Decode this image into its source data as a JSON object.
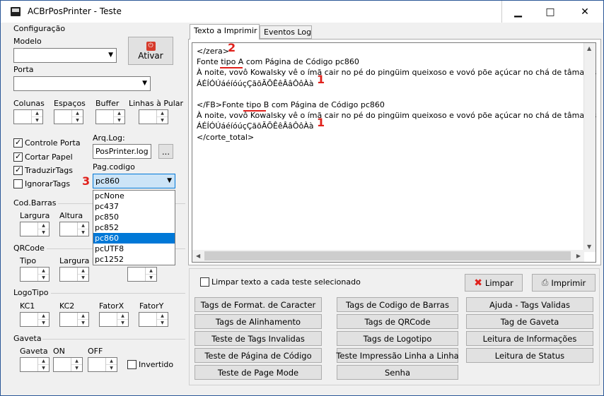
{
  "window": {
    "title": "ACBrPosPrinter - Teste",
    "minimize": "▁",
    "maximize": "□",
    "close": "✕"
  },
  "config": {
    "group_title": "Configuração",
    "modelo_label": "Modelo",
    "modelo_value": "",
    "ativar_label": "Ativar",
    "porta_label": "Porta",
    "porta_value": "",
    "colunas_label": "Colunas",
    "espacos_label": "Espaços",
    "buffer_label": "Buffer",
    "linhas_label": "Linhas à Pular",
    "controle_porta": "Controle Porta",
    "cortar_papel": "Cortar Papel",
    "traduzir_tags": "TraduzirTags",
    "ignorar_tags": "IgnorarTags",
    "arqlog_label": "Arq.Log:",
    "arqlog_value": "PosPrinter.log",
    "browse_label": "...",
    "pagcodigo_label": "Pag.codigo",
    "pagcodigo_value": "pc860",
    "pagcodigo_options": [
      "pcNone",
      "pc437",
      "pc850",
      "pc852",
      "pc860",
      "pcUTF8",
      "pc1252"
    ],
    "pagcodigo_selected_index": 4
  },
  "codbarras": {
    "title": "Cod.Barras",
    "largura": "Largura",
    "altura": "Altura"
  },
  "qrcode": {
    "title": "QRCode",
    "tipo": "Tipo",
    "largura": "Largura M"
  },
  "logotipo": {
    "title": "LogoTipo",
    "kc1": "KC1",
    "kc2": "KC2",
    "fatorx": "FatorX",
    "fatory": "FatorY"
  },
  "gaveta": {
    "title": "Gaveta",
    "gaveta": "Gaveta",
    "on": "ON",
    "off": "OFF",
    "invertido": "Invertido"
  },
  "tabs": {
    "imprimir": "Texto a Imprimir",
    "eventos": "Eventos Log"
  },
  "memo": {
    "lines": [
      "</zera>",
      "Fonte tipo A com Página de Código pc860",
      "À noite, vovô Kowalsky vê o ímã cair no pé do pingüim queixoso e vovó põe açúcar no chá de tâmaras",
      "ÁÉÍÓÚáéíóúçÇãõÃÕÊêÂâÔôÀà",
      "",
      "</FB>Fonte tipo B com Página de Código pc860",
      "À noite, vovô Kowalsky vê o ímã cair no pé do pingüim queixoso e vovó põe açúcar no chá de tâmaras",
      "ÁÉÍÓÚáéíóúçÇãõÃÕÊêÂâÔôÀà",
      "</corte_total>"
    ],
    "markers": [
      "2",
      "1",
      "1",
      "3"
    ]
  },
  "limpar_checkbox": "Limpar texto a cada teste selecionado",
  "limpar_button": "Limpar",
  "imprimir_button": "Imprimir",
  "buttons": [
    "Tags de Format. de Caracter",
    "Tags de Codigo de Barras",
    "Ajuda - Tags Validas",
    "Tags de Alinhamento",
    "Tags de QRCode",
    "Tag de Gaveta",
    "Teste de Tags Invalidas",
    "Tags de Logotipo",
    "Leitura de Informações",
    "Teste de Página de Código",
    "Teste Impressão Linha a Linha",
    "Leitura de Status",
    "Teste de Page Mode",
    "Senha"
  ]
}
